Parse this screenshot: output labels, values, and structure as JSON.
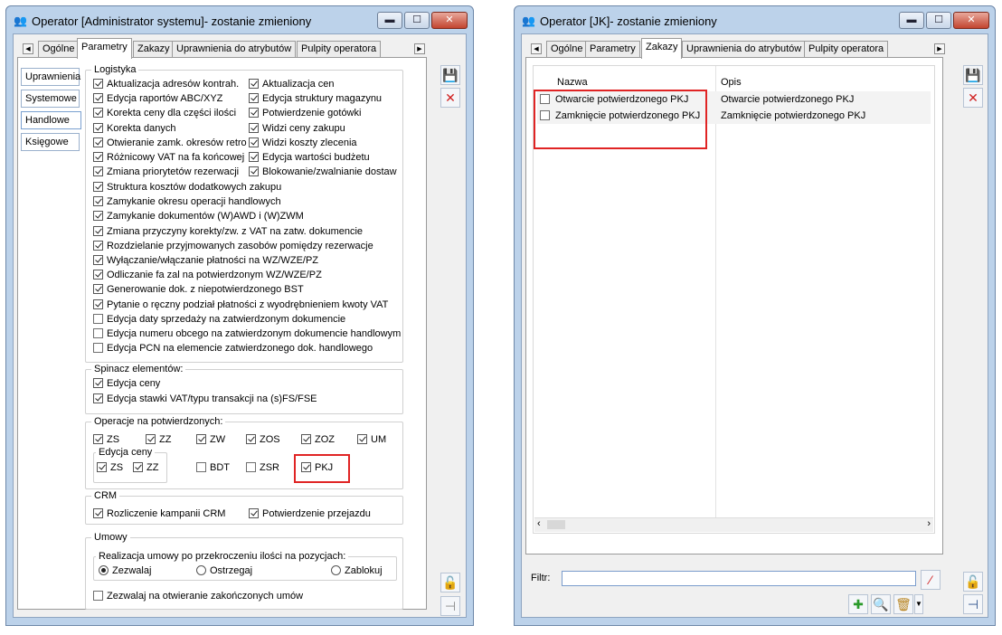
{
  "left_window": {
    "title": "Operator [Administrator systemu]- zostanie zmieniony",
    "tabs": [
      "Ogólne",
      "Parametry",
      "Zakazy",
      "Uprawnienia do atrybutów",
      "Pulpity operatora"
    ],
    "active_tab": "Parametry",
    "side_tabs": [
      "Uprawnienia",
      "Systemowe",
      "Handlowe",
      "Księgowe"
    ],
    "active_side_tab": "Handlowe",
    "logistyka": {
      "title": "Logistyka",
      "two_col": [
        {
          "label": "Aktualizacja adresów kontrah.",
          "checked": true
        },
        {
          "label": "Aktualizacja cen",
          "checked": true
        },
        {
          "label": "Edycja raportów ABC/XYZ",
          "checked": true
        },
        {
          "label": "Edycja struktury magazynu",
          "checked": true
        },
        {
          "label": "Korekta ceny dla części ilości",
          "checked": true
        },
        {
          "label": "Potwierdzenie gotówki",
          "checked": true
        },
        {
          "label": "Korekta danych",
          "checked": true
        },
        {
          "label": "Widzi ceny zakupu",
          "checked": true
        },
        {
          "label": "Otwieranie zamk. okresów retro",
          "checked": true
        },
        {
          "label": "Widzi koszty zlecenia",
          "checked": true
        },
        {
          "label": "Różnicowy VAT na fa końcowej",
          "checked": true
        },
        {
          "label": "Edycja wartości budżetu",
          "checked": true
        },
        {
          "label": "Zmiana priorytetów rezerwacji",
          "checked": true
        },
        {
          "label": "Blokowanie/zwalnianie dostaw",
          "checked": true
        }
      ],
      "one_col": [
        {
          "label": "Struktura kosztów dodatkowych zakupu",
          "checked": true
        },
        {
          "label": "Zamykanie okresu operacji handlowych",
          "checked": true
        },
        {
          "label": "Zamykanie dokumentów (W)AWD i (W)ZWM",
          "checked": true
        },
        {
          "label": "Zmiana przyczyny korekty/zw. z VAT na zatw. dokumencie",
          "checked": true
        },
        {
          "label": "Rozdzielanie przyjmowanych zasobów pomiędzy rezerwacje",
          "checked": true
        },
        {
          "label": "Wyłączanie/włączanie płatności na WZ/WZE/PZ",
          "checked": true
        },
        {
          "label": "Odliczanie fa zal na potwierdzonym WZ/WZE/PZ",
          "checked": true
        },
        {
          "label": "Generowanie dok. z niepotwierdzonego BST",
          "checked": true
        },
        {
          "label": "Pytanie o ręczny podział płatności z wyodrębnieniem kwoty VAT",
          "checked": true
        },
        {
          "label": "Edycja daty sprzedaży na zatwierdzonym dokumencie",
          "checked": false
        },
        {
          "label": "Edycja numeru obcego na zatwierdzonym dokumencie handlowym",
          "checked": false
        },
        {
          "label": "Edycja PCN na elemencie zatwierdzonego dok. handlowego",
          "checked": false
        }
      ]
    },
    "spinacz": {
      "title": "Spinacz elementów:",
      "items": [
        {
          "label": "Edycja ceny",
          "checked": true
        },
        {
          "label": "Edycja stawki VAT/typu transakcji na (s)FS/FSE",
          "checked": true
        }
      ]
    },
    "operacje": {
      "title": "Operacje na potwierdzonych:",
      "row1": [
        {
          "label": "ZS",
          "checked": true
        },
        {
          "label": "ZZ",
          "checked": true
        },
        {
          "label": "ZW",
          "checked": true
        },
        {
          "label": "ZOS",
          "checked": true
        },
        {
          "label": "ZOZ",
          "checked": true
        },
        {
          "label": "UM",
          "checked": true
        }
      ],
      "edycja_ceny_title": "Edycja ceny",
      "edycja_ceny": [
        {
          "label": "ZS",
          "checked": true
        },
        {
          "label": "ZZ",
          "checked": true
        }
      ],
      "row2": [
        {
          "label": "BDT",
          "checked": false
        },
        {
          "label": "ZSR",
          "checked": false
        },
        {
          "label": "PKJ",
          "checked": true
        }
      ]
    },
    "crm": {
      "title": "CRM",
      "items": [
        {
          "label": "Rozliczenie kampanii CRM",
          "checked": true
        },
        {
          "label": "Potwierdzenie przejazdu",
          "checked": true
        }
      ]
    },
    "umowy": {
      "title": "Umowy",
      "realizacja_title": "Realizacja umowy po przekroczeniu ilości na pozycjach:",
      "options": [
        "Zezwalaj",
        "Ostrzegaj",
        "Zablokuj"
      ],
      "selected": "Zezwalaj",
      "zezwalaj_otwieranie": {
        "label": "Zezwalaj na otwieranie zakończonych umów",
        "checked": false
      }
    }
  },
  "right_window": {
    "title": "Operator [JK]- zostanie zmieniony",
    "tabs": [
      "Ogólne",
      "Parametry",
      "Zakazy",
      "Uprawnienia do atrybutów",
      "Pulpity operatora"
    ],
    "active_tab": "Zakazy",
    "columns": [
      "Nazwa",
      "Opis"
    ],
    "rows": [
      {
        "nazwa": "Otwarcie potwierdzonego PKJ",
        "opis": "Otwarcie potwierdzonego PKJ",
        "checked": false
      },
      {
        "nazwa": "Zamknięcie potwierdzonego PKJ",
        "opis": "Zamknięcie potwierdzonego PKJ",
        "checked": false
      }
    ],
    "filter_label": "Filtr:",
    "filter_value": ""
  },
  "colors": {
    "window_frame": "#bcd2ea",
    "highlight_red": "#e02424",
    "client_bg": "#f0f0f0"
  }
}
